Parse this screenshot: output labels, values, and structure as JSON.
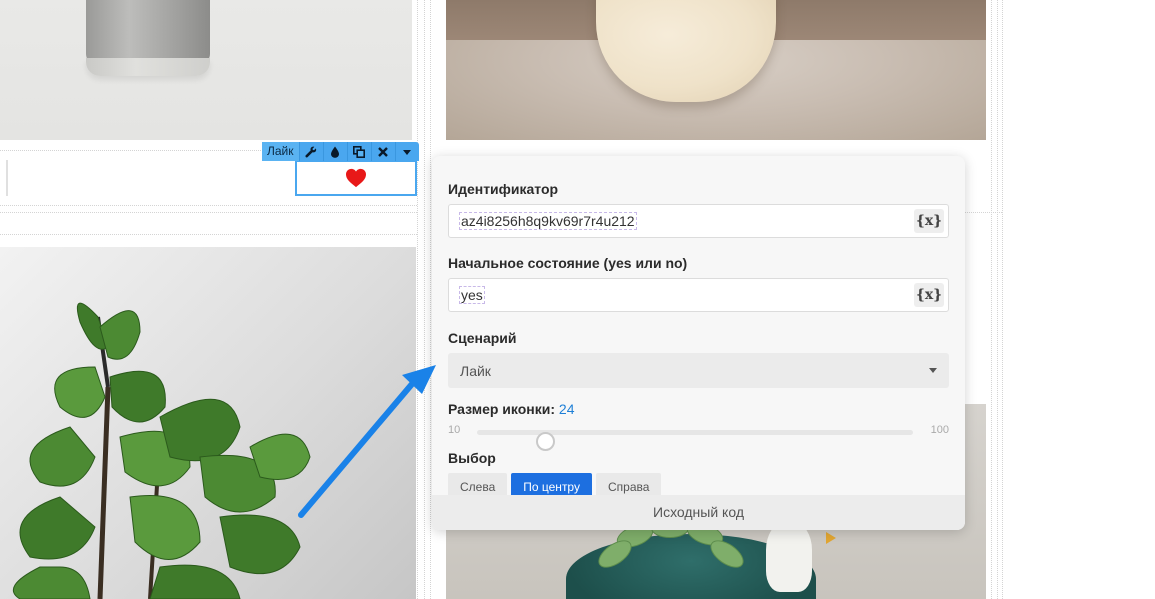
{
  "widget": {
    "toolbar_label": "Лайк",
    "toolbar_icons": [
      "wrench-icon",
      "drop-icon",
      "duplicate-icon",
      "close-icon",
      "caret-down-icon"
    ],
    "icon": "heart-icon",
    "accent": "#4aa7ef",
    "heart_color": "#e81818"
  },
  "panel": {
    "id_label": "Идентификатор",
    "id_value": "az4i8256h8q9kv69r7r4u212",
    "variable_glyph": "{x}",
    "state_label": "Начальное состояние (yes или no)",
    "state_value": "yes",
    "scenario_label": "Сценарий",
    "scenario_value": "Лайк",
    "icon_size_label": "Размер иконки:",
    "icon_size_value": "24",
    "slider_min": "10",
    "slider_max": "100",
    "slider_level": 24,
    "choice_label": "Выбор",
    "choices": [
      "Слева",
      "По центру",
      "Справа"
    ],
    "active_choice": "По центру",
    "footer_label": "Исходный код",
    "active_color": "#1d6fe0"
  },
  "annotation": {
    "arrow_color": "#1a82e8"
  }
}
